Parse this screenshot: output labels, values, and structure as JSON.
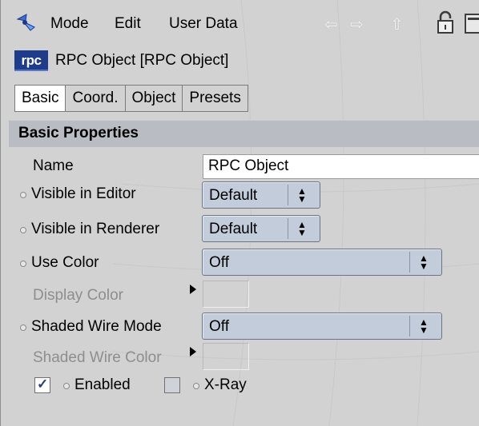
{
  "menu": {
    "items": [
      "Mode",
      "Edit",
      "User Data"
    ]
  },
  "object": {
    "badge": "rpc",
    "title": "RPC Object [RPC Object]"
  },
  "tabs": [
    {
      "label": "Basic",
      "active": true
    },
    {
      "label": "Coord.",
      "active": false
    },
    {
      "label": "Object",
      "active": false
    },
    {
      "label": "Presets",
      "active": false
    }
  ],
  "section": {
    "title": "Basic Properties"
  },
  "fields": {
    "name": {
      "label": "Name",
      "value": "RPC Object"
    },
    "visible_editor": {
      "label": "Visible in Editor",
      "value": "Default"
    },
    "visible_renderer": {
      "label": "Visible in Renderer",
      "value": "Default"
    },
    "use_color": {
      "label": "Use Color",
      "value": "Off"
    },
    "display_color": {
      "label": "Display Color"
    },
    "shaded_wire_mode": {
      "label": "Shaded Wire Mode",
      "value": "Off"
    },
    "shaded_wire_color": {
      "label": "Shaded Wire Color"
    },
    "enabled": {
      "label": "Enabled",
      "checked": true
    },
    "xray": {
      "label": "X-Ray",
      "checked": false
    }
  },
  "colors": {
    "badge_bg": "#1f3c8a",
    "section_bg": "#b9bcc2",
    "dropdown_bg": "#c2ccdb"
  },
  "icons": [
    "app-icon",
    "back-arrow-icon",
    "forward-arrow-icon",
    "up-arrow-icon",
    "lock-icon",
    "panel-icon"
  ]
}
